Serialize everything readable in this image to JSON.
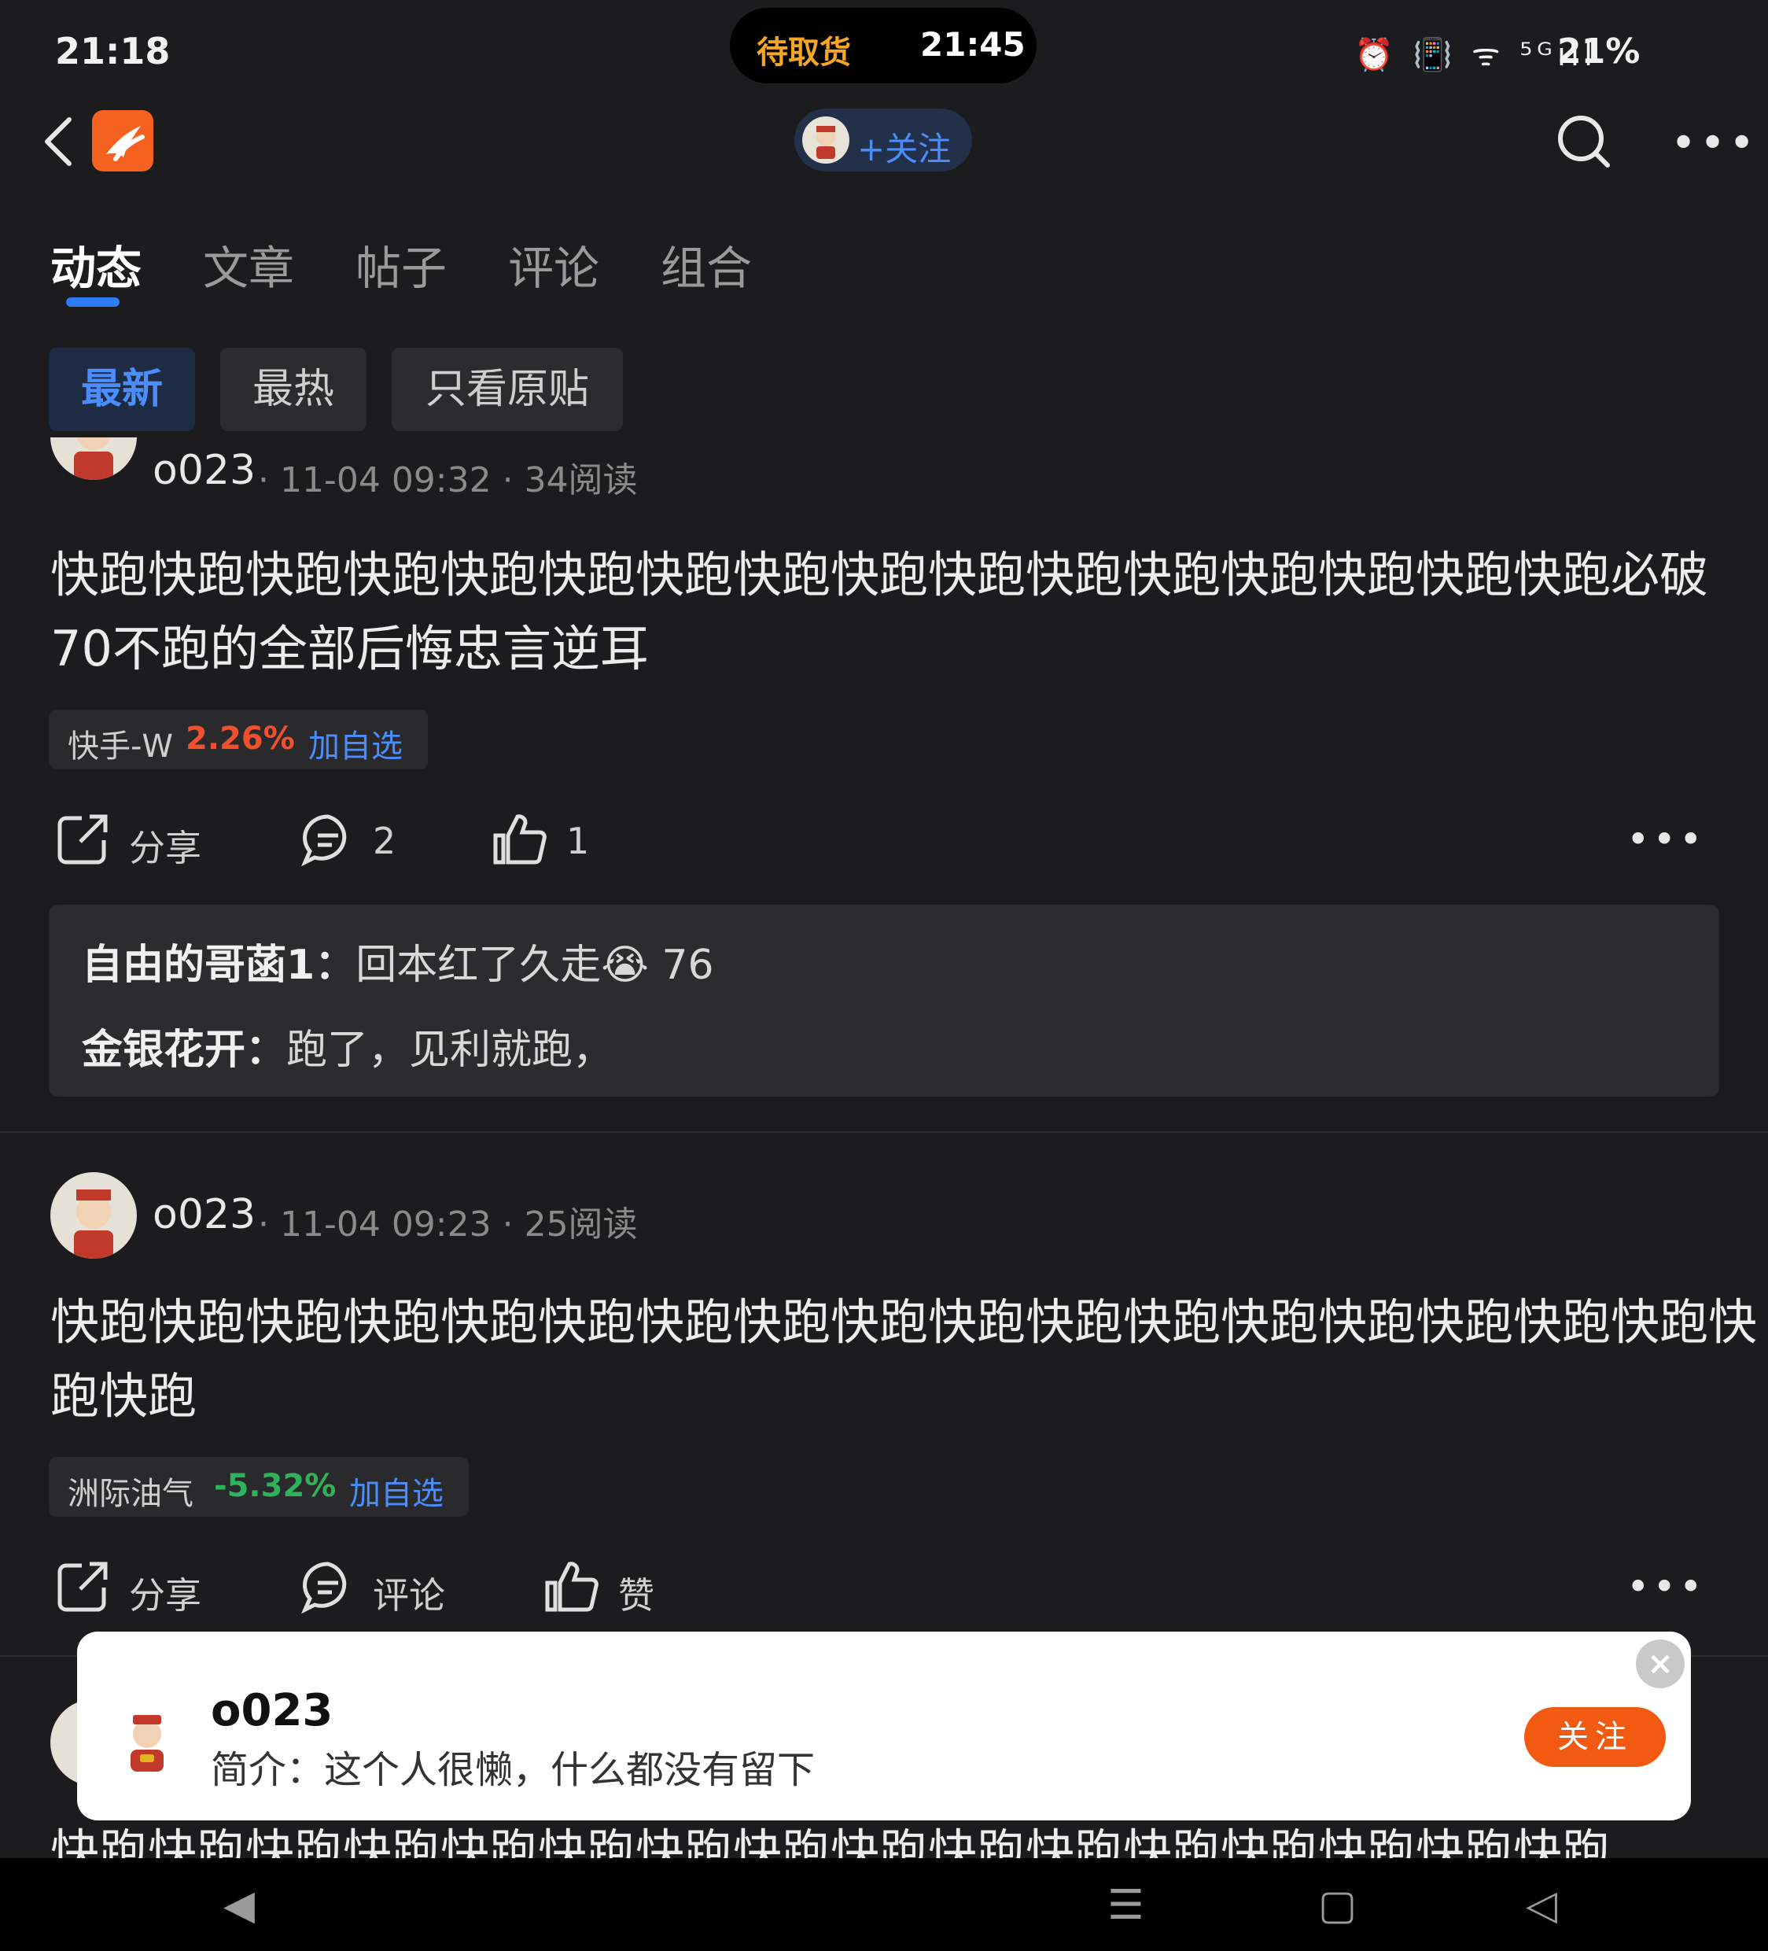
{
  "status_bar": {
    "time": "21:18",
    "pill_left": "待取货",
    "pill_right": "21:45",
    "icons": "⏰ 📳 ᯤ ⁵ᴳıll",
    "battery": "21%"
  },
  "header": {
    "follow_label": "+关注",
    "back_icon": "back-icon",
    "more": "•••"
  },
  "tabs": [
    "动态",
    "文章",
    "帖子",
    "评论",
    "组合"
  ],
  "filters": [
    "最新",
    "最热",
    "只看原贴"
  ],
  "posts": [
    {
      "author": "o023",
      "meta": "· 11-04 09:32 · 34阅读",
      "body": "快跑快跑快跑快跑快跑快跑快跑快跑快跑快跑快跑快跑快跑快跑快跑快跑必破70不跑的全部后悔忠言逆耳",
      "stock": {
        "name": "快手-W",
        "pct": "2.26%",
        "add": "加自选"
      },
      "actions": {
        "share": "分享",
        "comment": "2",
        "like": "1"
      },
      "comments": [
        {
          "name": "自由的哥菡1：",
          "text": "回本红了久走😭 76"
        },
        {
          "name": "金银花开：",
          "text": "跑了，见利就跑，"
        }
      ]
    },
    {
      "author": "o023",
      "meta": "· 11-04 09:23 · 25阅读",
      "body": "快跑快跑快跑快跑快跑快跑快跑快跑快跑快跑快跑快跑快跑快跑快跑快跑快跑快跑快跑",
      "stock": {
        "name": "洲际油气",
        "pct": "-5.32%",
        "add": "加自选"
      },
      "actions": {
        "share": "分享",
        "comment": "评论",
        "like": "赞"
      }
    },
    {
      "body": "快跑快跑快跑快跑快跑快跑快跑快跑快跑快跑快跑快跑快跑快跑快跑快跑"
    }
  ],
  "popup": {
    "name": "o023",
    "bio": "简介：这个人很懒，什么都没有留下",
    "follow": "关注",
    "close": "×"
  },
  "nav": {
    "left": "◀",
    "menu": "☰",
    "home": "▢",
    "back": "◁"
  }
}
